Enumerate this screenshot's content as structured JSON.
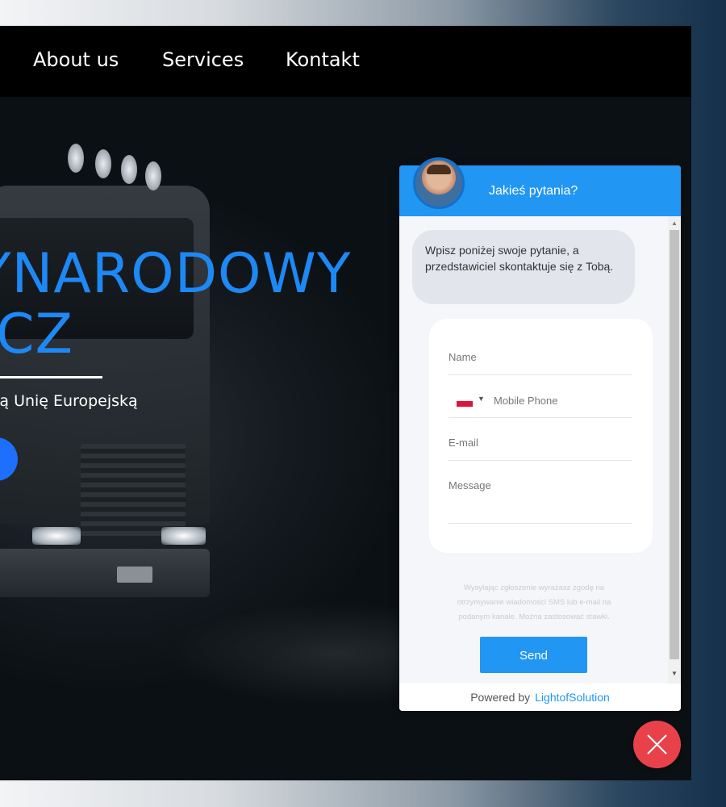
{
  "nav": {
    "items": [
      {
        "label": "About us"
      },
      {
        "label": "Services"
      },
      {
        "label": "Kontakt"
      }
    ]
  },
  "hero": {
    "title_line1": "YNARODOWY",
    "title_line2": "ICZ",
    "subtitle": "łą Unię Europejską"
  },
  "chat": {
    "header_title": "Jakieś pytania?",
    "intro_message": "Wpisz poniżej swoje pytanie, a przedstawiciel skontaktuje się z Tobą.",
    "form": {
      "name_placeholder": "Name",
      "phone_placeholder": "Mobile Phone",
      "email_placeholder": "E-mail",
      "message_placeholder": "Message"
    },
    "consent_text": "Wysyłając zgłoszenie wyrażasz zgodę na otrzymywanie wiadomości SMS lub e-mail na podanym kanale. Można zastosować stawki.",
    "send_label": "Send",
    "powered_by": "Powered by",
    "powered_link": "LightofSolution"
  },
  "icons": {
    "phone_country_flag": "poland-flag-icon",
    "close": "close-icon",
    "scroll_up": "scroll-up-arrow",
    "scroll_down": "scroll-down-arrow"
  },
  "colors": {
    "accent": "#2196f3",
    "hero_title": "#1e88f5",
    "close_button": "#e8414a",
    "cta": "#1f6fff"
  }
}
